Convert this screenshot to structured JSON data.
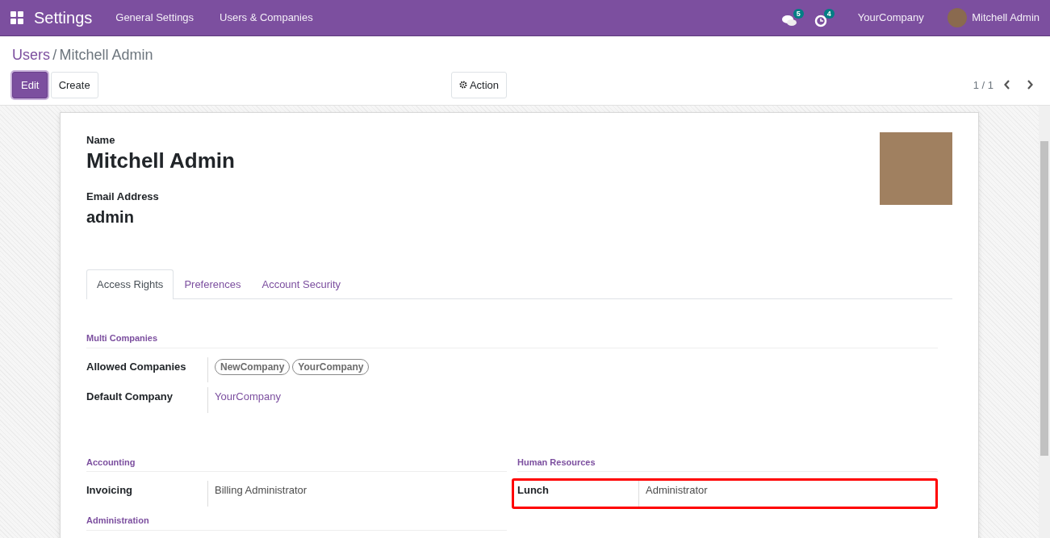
{
  "navbar": {
    "app_title": "Settings",
    "menus": [
      "General Settings",
      "Users & Companies"
    ],
    "messages_count": "5",
    "activities_count": "4",
    "company": "YourCompany",
    "user": "Mitchell Admin"
  },
  "breadcrumb": [
    {
      "label": "Users",
      "kind": "link"
    },
    {
      "label": "/",
      "kind": "separator"
    },
    {
      "label": "Mitchell Admin",
      "kind": "current"
    }
  ],
  "buttons": [
    {
      "label": "Edit",
      "kind": "primary"
    },
    {
      "label": "Create",
      "kind": "secondary"
    }
  ],
  "action_button": "Action",
  "pager": "1 / 1",
  "form": {
    "name_label": "Name",
    "name": "Mitchell Admin",
    "email_label": "Email Address",
    "email": "admin",
    "tabs": [
      {
        "label": "Access Rights",
        "selected": true
      },
      {
        "label": "Preferences",
        "selected": false
      },
      {
        "label": "Account Security",
        "selected": false
      }
    ],
    "sections": [
      {
        "title": "Multi Companies",
        "fields": [
          {
            "label": "Allowed Companies",
            "kind": "tags",
            "values": [
              "NewCompany",
              "YourCompany"
            ],
            "highlighted": false
          },
          {
            "label": "Default Company",
            "kind": "link",
            "value": "YourCompany",
            "highlighted": false
          }
        ]
      }
    ],
    "left_sections": [
      {
        "title": "Accounting",
        "fields": [
          {
            "label": "Invoicing",
            "kind": "text",
            "value": "Billing Administrator",
            "highlighted": false
          }
        ]
      },
      {
        "title": "Administration"
      }
    ],
    "right_sections": [
      {
        "title": "Human Resources",
        "fields": [
          {
            "label": "Lunch",
            "kind": "text",
            "value": "Administrator",
            "highlighted": true
          }
        ]
      }
    ]
  }
}
